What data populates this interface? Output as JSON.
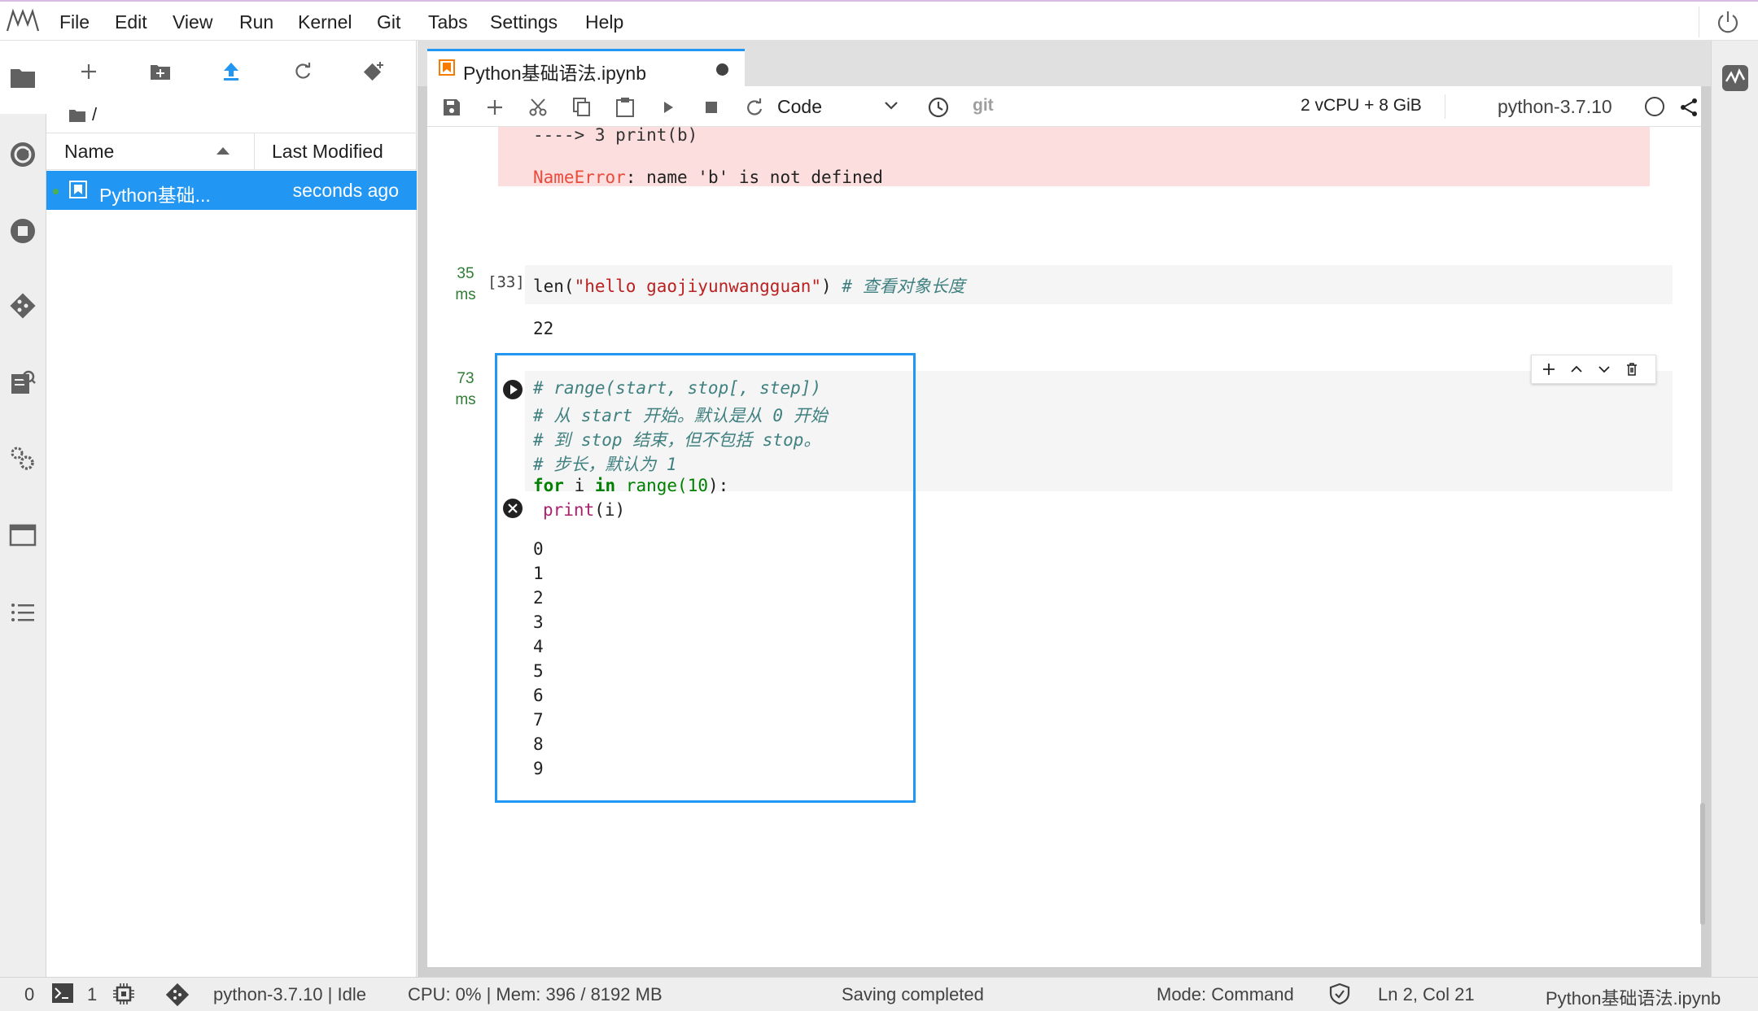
{
  "menubar": {
    "items": [
      "File",
      "Edit",
      "View",
      "Run",
      "Kernel",
      "Git",
      "Tabs",
      "Settings",
      "Help"
    ]
  },
  "filebrowser": {
    "path": "/",
    "columns": {
      "name": "Name",
      "modified": "Last Modified"
    },
    "rows": [
      {
        "name": "Python基础...",
        "modified": "seconds ago"
      }
    ]
  },
  "tab": {
    "title": "Python基础语法.ipynb"
  },
  "toolbar": {
    "cell_type": "Code",
    "git": "git",
    "resources": "2 vCPU + 8 GiB",
    "kernel": "python-3.7.10"
  },
  "notebook": {
    "error_line1": "----> 3 print(b)",
    "error_name": "NameError",
    "error_msg": ": name 'b' is not defined",
    "cell33": {
      "timing_value": "35",
      "timing_unit": "ms",
      "prompt": "[33]",
      "code_func": "len(",
      "code_string": "\"hello gaojiyunwangguan\"",
      "code_close": ") ",
      "code_comment": "# 查看对象长度",
      "output": "22"
    },
    "cell34": {
      "timing_value": "73",
      "timing_unit": "ms",
      "comments": [
        "# range(start, stop[, step])",
        "# 从 start 开始。默认是从 0 开始",
        "# 到 stop 结束，但不包括 stop。",
        "# 步长，默认为 1"
      ],
      "for_kw": "for",
      "for_var": " i ",
      "in_kw": "in",
      "range_fn": " range(",
      "range_arg": "10",
      "range_close": "):",
      "print_fn": "print",
      "print_arg": "(i)",
      "outputs": [
        "0",
        "1",
        "2",
        "3",
        "4",
        "5",
        "6",
        "7",
        "8",
        "9"
      ]
    }
  },
  "statusbar": {
    "terminals": "0",
    "kernels": "1",
    "kernel_status": "python-3.7.10 | Idle",
    "cpu_mem": "CPU: 0% | Mem: 396 / 8192 MB",
    "saving": "Saving completed",
    "mode": "Mode: Command",
    "position": "Ln 2, Col 21",
    "filename": "Python基础语法.ipynb"
  },
  "colors": {
    "accent": "#2196f3",
    "error_bg": "#fddede",
    "timing_green": "#2e7d32",
    "comment": "#408080",
    "string": "#ba2121",
    "keyword": "#008000"
  },
  "icons": {
    "menubar": [
      "jupyter-logo-icon",
      "power-icon"
    ],
    "activitybar": [
      "folder-icon",
      "running-icon",
      "stop-icon",
      "git-icon",
      "property-inspector-icon",
      "extensions-icon",
      "tabs-icon",
      "toc-icon"
    ],
    "filebrowser": [
      "new-launcher-icon",
      "new-folder-icon",
      "upload-icon",
      "refresh-icon",
      "git-clone-icon"
    ],
    "toolbar": [
      "save-icon",
      "add-cell-icon",
      "cut-icon",
      "copy-icon",
      "paste-icon",
      "run-icon",
      "stop-icon",
      "restart-icon",
      "history-icon",
      "share-icon"
    ]
  }
}
